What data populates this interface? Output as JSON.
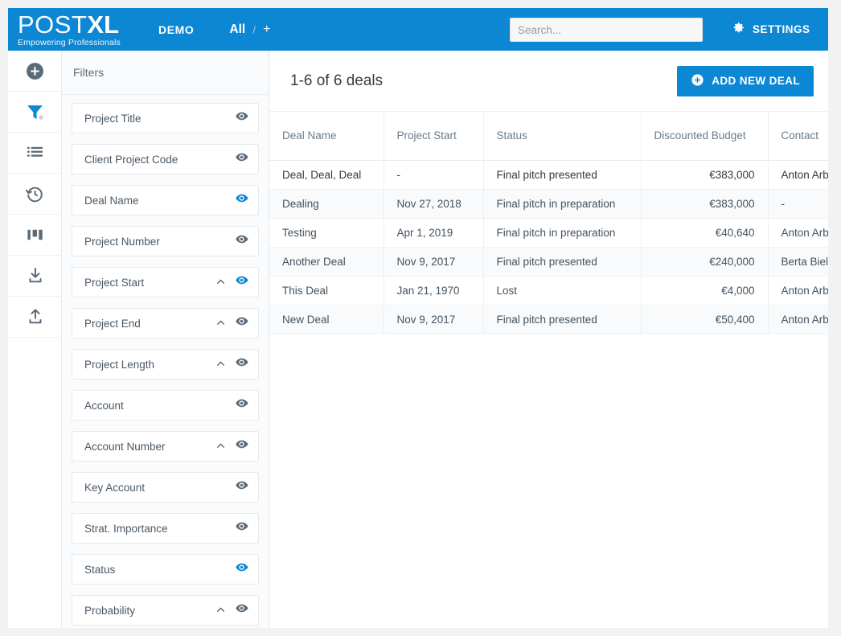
{
  "header": {
    "logo_post": "POST",
    "logo_xl": "XL",
    "logo_tagline": "Empowering Professionals",
    "demo_label": "DEMO",
    "view_all": "All",
    "view_separator": "/",
    "view_add": "+",
    "search_placeholder": "Search...",
    "settings_label": "SETTINGS",
    "settings_icon": "gear-icon",
    "background_color": "#0c87d4"
  },
  "rail": {
    "items": [
      {
        "icon": "plus-circle-icon",
        "name": "add",
        "active": false
      },
      {
        "icon": "filter-icon",
        "name": "filters",
        "active": true
      },
      {
        "icon": "list-icon",
        "name": "list",
        "active": false
      },
      {
        "icon": "history-icon",
        "name": "history",
        "active": false
      },
      {
        "icon": "columns-icon",
        "name": "columns",
        "active": false
      },
      {
        "icon": "download-icon",
        "name": "download",
        "active": false
      },
      {
        "icon": "upload-icon",
        "name": "upload",
        "active": false
      }
    ]
  },
  "filters": {
    "title": "Filters",
    "items": [
      {
        "label": "Project Title",
        "eye_active": false,
        "has_chevron": false
      },
      {
        "label": "Client Project Code",
        "eye_active": false,
        "has_chevron": false
      },
      {
        "label": "Deal Name",
        "eye_active": true,
        "has_chevron": false
      },
      {
        "label": "Project Number",
        "eye_active": false,
        "has_chevron": false
      },
      {
        "label": "Project Start",
        "eye_active": true,
        "has_chevron": true
      },
      {
        "label": "Project End",
        "eye_active": false,
        "has_chevron": true
      },
      {
        "label": "Project Length",
        "eye_active": false,
        "has_chevron": true
      },
      {
        "label": "Account",
        "eye_active": false,
        "has_chevron": false
      },
      {
        "label": "Account Number",
        "eye_active": false,
        "has_chevron": true
      },
      {
        "label": "Key Account",
        "eye_active": false,
        "has_chevron": false
      },
      {
        "label": "Strat. Importance",
        "eye_active": false,
        "has_chevron": false
      },
      {
        "label": "Status",
        "eye_active": true,
        "has_chevron": false
      },
      {
        "label": "Probability",
        "eye_active": false,
        "has_chevron": true
      }
    ],
    "eye_active_color": "#0c87d4",
    "eye_inactive_color": "#5b6a78"
  },
  "main": {
    "deals_count": "1-6 of 6 deals",
    "add_deal_label": "ADD NEW DEAL",
    "add_deal_icon": "plus-circle-icon",
    "columns": [
      "Deal Name",
      "Project Start",
      "Status",
      "Discounted Budget",
      "Contact"
    ],
    "rows": [
      {
        "deal": "Deal, Deal, Deal",
        "start": "-",
        "status": "Final pitch presented",
        "budget": "€383,000",
        "contact": "Anton Arbe"
      },
      {
        "deal": "Dealing",
        "start": "Nov 27, 2018",
        "status": "Final pitch in preparation",
        "budget": "€383,000",
        "contact": "-"
      },
      {
        "deal": "Testing",
        "start": "Apr 1, 2019",
        "status": "Final pitch in preparation",
        "budget": "€40,640",
        "contact": "Anton Arbe"
      },
      {
        "deal": "Another Deal",
        "start": "Nov 9, 2017",
        "status": "Final pitch presented",
        "budget": "€240,000",
        "contact": "Berta Bieles"
      },
      {
        "deal": "This Deal",
        "start": "Jan 21, 1970",
        "status": "Lost",
        "budget": "€4,000",
        "contact": "Anton Arbe"
      },
      {
        "deal": "New Deal",
        "start": "Nov 9, 2017",
        "status": "Final pitch presented",
        "budget": "€50,400",
        "contact": "Anton Arbe"
      }
    ]
  }
}
